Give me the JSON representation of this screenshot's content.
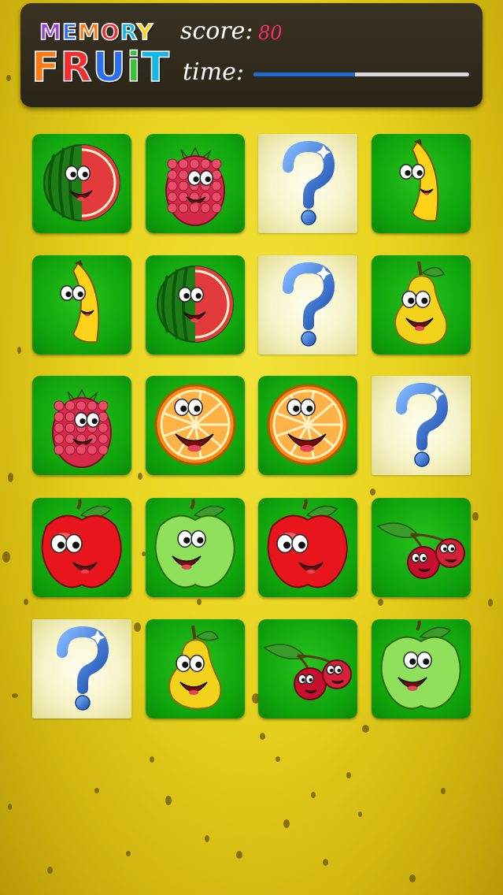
{
  "logo": {
    "line1": [
      {
        "ch": "M",
        "color": "l-purple"
      },
      {
        "ch": "E",
        "color": "l-blue"
      },
      {
        "ch": "M",
        "color": "l-orange"
      },
      {
        "ch": "O",
        "color": "l-red"
      },
      {
        "ch": "R",
        "color": "l-cyan"
      },
      {
        "ch": "Y",
        "color": "l-yellow"
      }
    ],
    "line2": [
      {
        "ch": "F",
        "color": "l-orange"
      },
      {
        "ch": "R",
        "color": "l-red"
      },
      {
        "ch": "U",
        "color": "l-blue"
      },
      {
        "ch": "i",
        "color": "l-green"
      },
      {
        "ch": "T",
        "color": "l-cyan"
      }
    ]
  },
  "hud": {
    "score_label": "score:",
    "score_value": "80",
    "time_label": "time:",
    "time_remaining_fraction": 0.47
  },
  "board": {
    "rows": 5,
    "cols": 4,
    "cards": [
      "watermelon",
      "raspberry",
      "hidden",
      "banana",
      "banana",
      "watermelon",
      "hidden",
      "pear",
      "raspberry",
      "orange",
      "orange",
      "hidden",
      "red-apple",
      "green-apple",
      "red-apple",
      "cherries",
      "hidden",
      "pear",
      "cherries",
      "green-apple"
    ]
  },
  "colors": {
    "card_green": "#12a80f",
    "timer_fill": "#1f6bd6",
    "score_value": "#ff2a6a"
  }
}
